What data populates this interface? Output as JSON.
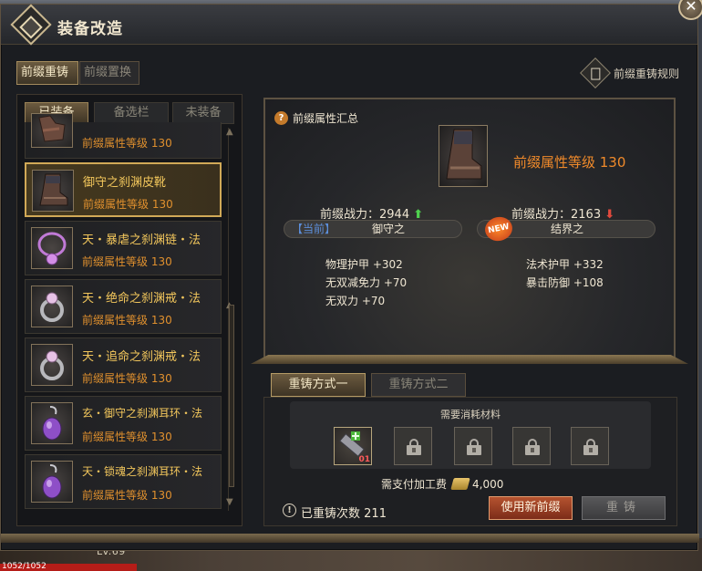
{
  "window": {
    "title": "装备改造"
  },
  "close": {
    "label": "✕"
  },
  "top_tabs": [
    {
      "label": "前缀重铸"
    },
    {
      "label": "前缀置换"
    }
  ],
  "rules_label": "前缀重铸规则",
  "sub_tabs": [
    {
      "label": "已装备"
    },
    {
      "label": "备选栏"
    },
    {
      "label": "未装备"
    }
  ],
  "items": [
    {
      "name": "",
      "level": "前缀属性等级 130",
      "icon": "gloves-icon"
    },
    {
      "name": "御守之刹渊皮靴",
      "level": "前缀属性等级 130",
      "icon": "boots-icon"
    },
    {
      "name": "天・暴虐之刹渊链・法",
      "level": "前缀属性等级 130",
      "icon": "necklace-icon"
    },
    {
      "name": "天・绝命之刹渊戒・法",
      "level": "前缀属性等级 130",
      "icon": "ring-icon"
    },
    {
      "name": "天・追命之刹渊戒・法",
      "level": "前缀属性等级 130",
      "icon": "ring-icon"
    },
    {
      "name": "玄・御守之刹渊耳环・法",
      "level": "前缀属性等级 130",
      "icon": "earring-icon"
    },
    {
      "name": "天・锁魂之刹渊耳环・法",
      "level": "前缀属性等级 130",
      "icon": "earring-icon"
    }
  ],
  "summary": {
    "title": "前缀属性汇总",
    "level": "前缀属性等级 130",
    "current": {
      "power_label": "前缀战力：",
      "power_value": "2944",
      "tag": "【当前】",
      "prefix": "御守之",
      "stats": [
        "物理护甲 +302",
        "无双减免力 +70",
        "无双力 +70"
      ]
    },
    "new": {
      "power_label": "前缀战力：",
      "power_value": "2163",
      "badge": "NEW",
      "prefix": "结界之",
      "stats": [
        "法术护甲 +332",
        "暴击防御 +108"
      ]
    }
  },
  "bottom_tabs": [
    {
      "label": "重铸方式一"
    },
    {
      "label": "重铸方式二"
    }
  ],
  "materials": {
    "title": "需要消耗材料",
    "slot_count": 5,
    "first_count": "01"
  },
  "fee": {
    "label": "需支付加工费",
    "amount": "4,000"
  },
  "recast_count": {
    "label": "已重铸次数",
    "value": "211"
  },
  "buttons": {
    "use_new": "使用新前缀",
    "recast": "重铸"
  },
  "hud": {
    "level": "Lv.69",
    "hp": "1052/1052"
  },
  "colors": {
    "gold_text": "#f3c75c",
    "level_orange": "#e0902e",
    "up_green": "#4fd24f",
    "down_red": "#e0493d",
    "current_blue": "#5c8ed9"
  }
}
